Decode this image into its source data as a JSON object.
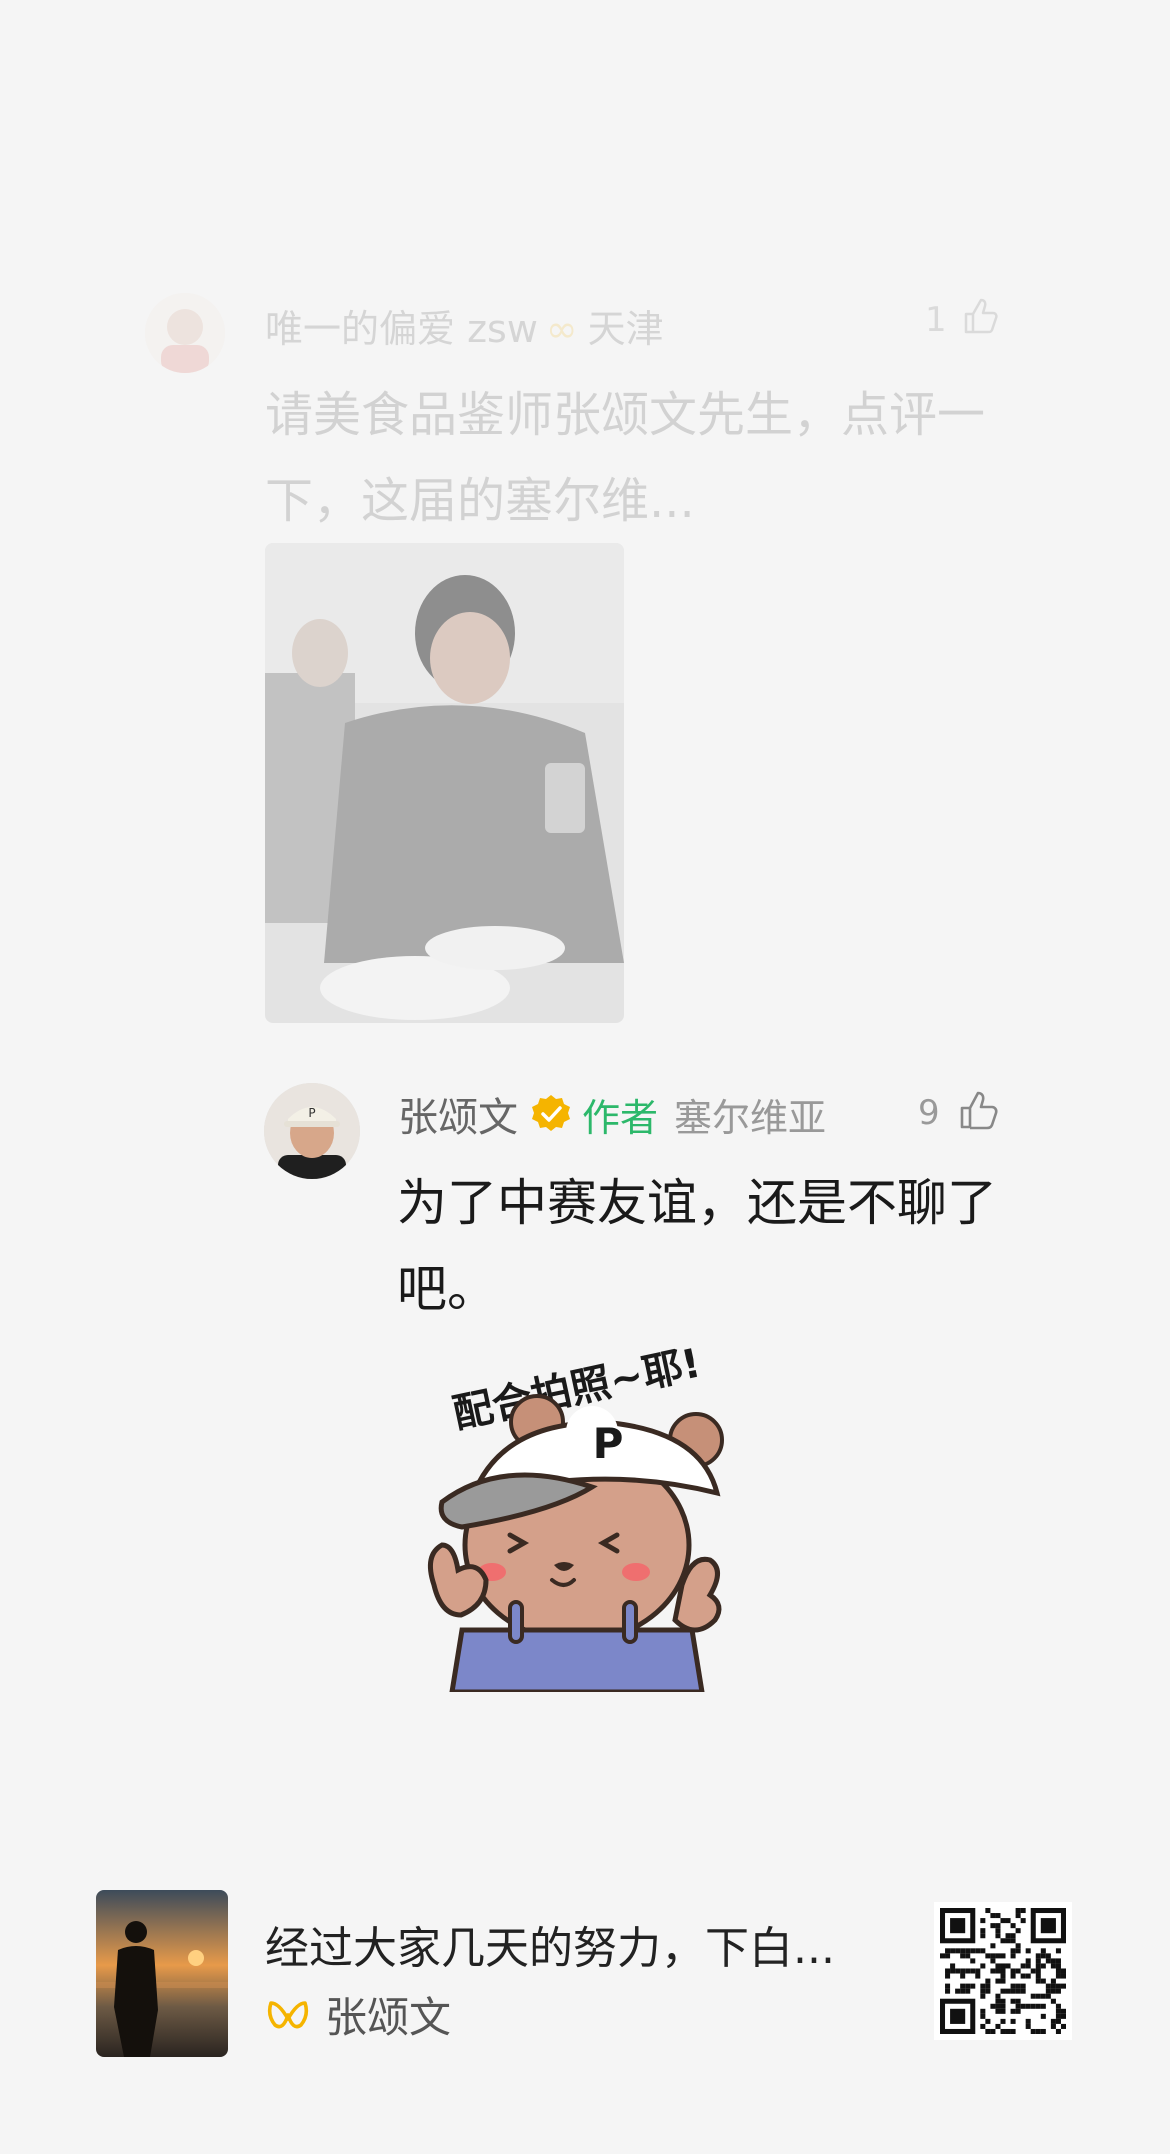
{
  "parent_comment": {
    "username": "唯一的偏爱 zsw",
    "badge_icon": "infinity-badge-icon",
    "badge_text": "天津",
    "like_count": "1",
    "text": "请美食品鉴师张颂文先生，点评一下，这届的塞尔维...",
    "photo": "man-at-dinner-table-photo"
  },
  "reply": {
    "username": "张颂文",
    "verified_icon": "verified-badge-icon",
    "author_tag": "作者",
    "location": "塞尔维亚",
    "like_count": "9",
    "text": "为了中赛友谊，还是不聊了吧。",
    "sticker": {
      "caption": "配合拍照~耶!",
      "cap_letter": "P"
    }
  },
  "bottom_card": {
    "post_title": "经过大家几天的努力，下白...",
    "author": "张颂文",
    "author_logo": "weibo-logo-icon",
    "thumbnail": "sunset-silhouette-photo",
    "qr": "qr-code"
  },
  "colors": {
    "background": "#f5f5f5",
    "author_tag": "#2cb86a",
    "verified": "#f5b400"
  }
}
